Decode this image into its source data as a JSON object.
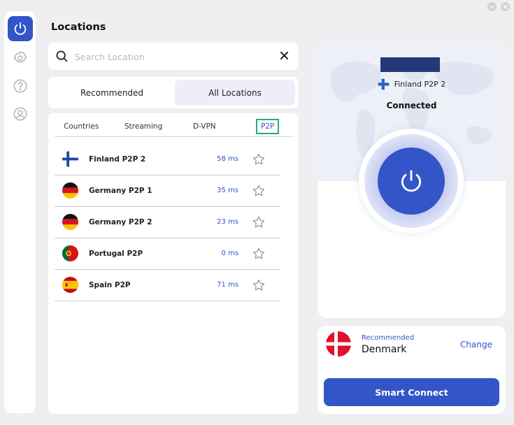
{
  "window_controls": {
    "minimize": "–",
    "close": "×"
  },
  "sidebar": {
    "items": [
      {
        "name": "power",
        "icon": "power-icon",
        "active": true
      },
      {
        "name": "settings",
        "icon": "gear-icon",
        "active": false
      },
      {
        "name": "help",
        "icon": "question-icon",
        "active": false
      },
      {
        "name": "account",
        "icon": "user-icon",
        "active": false
      }
    ]
  },
  "page": {
    "title": "Locations"
  },
  "search": {
    "placeholder": "Search Location",
    "value": ""
  },
  "segments": {
    "recommended": "Recommended",
    "all_locations": "All Locations",
    "selected": "all_locations"
  },
  "tabs": {
    "countries": "Countries",
    "streaming": "Streaming",
    "dvpn": "D-VPN",
    "p2p": "P2P",
    "active": "p2p"
  },
  "servers": [
    {
      "name": "Finland P2P 2",
      "ping": "58 ms",
      "flag": "finland"
    },
    {
      "name": "Germany P2P 1",
      "ping": "35 ms",
      "flag": "germany"
    },
    {
      "name": "Germany P2P 2",
      "ping": "23 ms",
      "flag": "germany"
    },
    {
      "name": "Portugal P2P",
      "ping": "0 ms",
      "flag": "portugal"
    },
    {
      "name": "Spain P2P",
      "ping": "71 ms",
      "flag": "spain"
    }
  ],
  "status": {
    "location": "Finland P2P 2",
    "state": "Connected"
  },
  "recommended": {
    "label": "Recommended",
    "country": "Denmark",
    "change": "Change"
  },
  "smart_connect": "Smart Connect",
  "colors": {
    "accent": "#3355c8",
    "background": "#efeff1",
    "ip_mask": "#243a78",
    "tab_highlight": "#2aaa7a"
  }
}
